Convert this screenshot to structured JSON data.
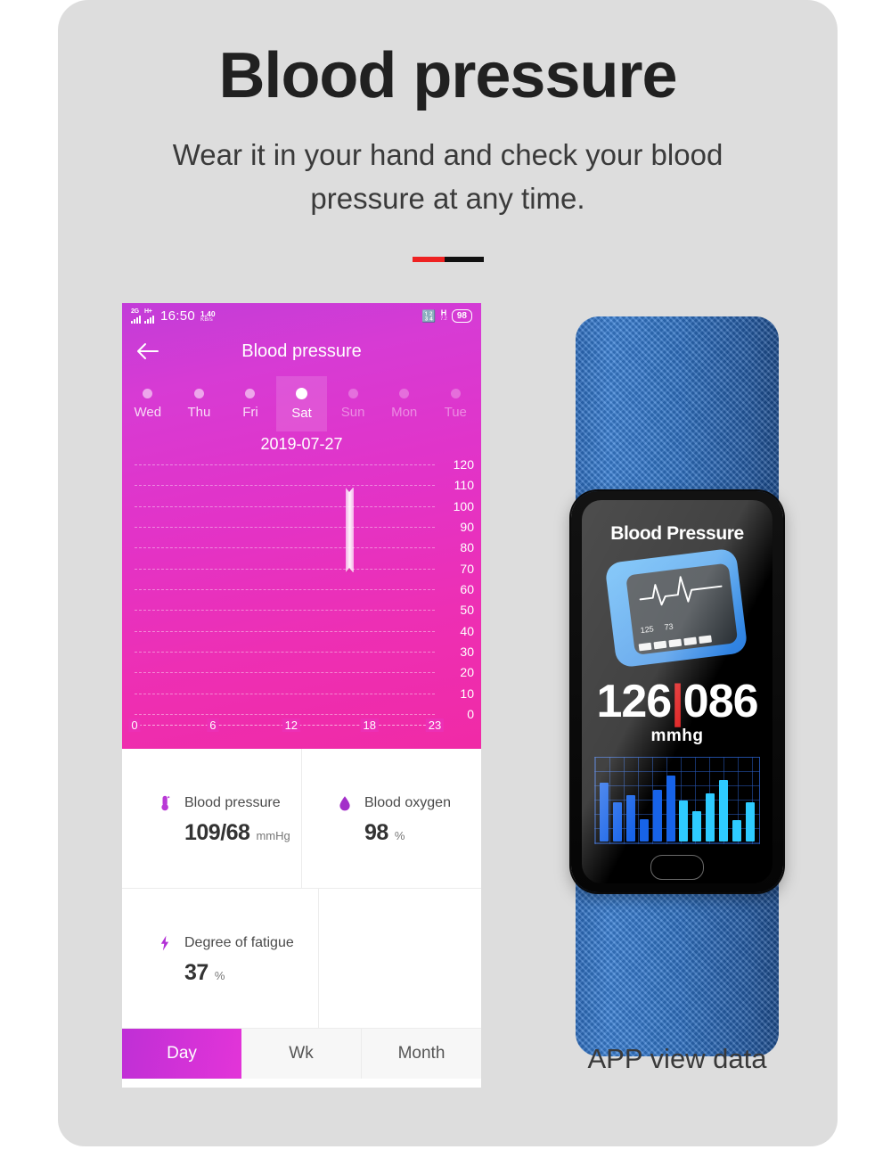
{
  "header": {
    "headline": "Blood pressure",
    "subline": "Wear it in your hand and check your blood pressure at any time.",
    "divider_red": "#ee2222",
    "divider_black": "#111111"
  },
  "phone": {
    "statusbar": {
      "net1": "2G",
      "net2": "H+",
      "time": "16:50",
      "speed_value": "1.40",
      "speed_unit": "KB/s",
      "bluetooth_icon": "bluetooth-icon",
      "hspa": "H",
      "hspa_sub": "7.2",
      "battery": "98"
    },
    "nav": {
      "back_icon": "back-arrow-icon",
      "title": "Blood pressure"
    },
    "days": [
      {
        "label": "Wed",
        "state": "normal"
      },
      {
        "label": "Thu",
        "state": "normal"
      },
      {
        "label": "Fri",
        "state": "normal"
      },
      {
        "label": "Sat",
        "state": "selected"
      },
      {
        "label": "Sun",
        "state": "dim"
      },
      {
        "label": "Mon",
        "state": "dim"
      },
      {
        "label": "Tue",
        "state": "dim"
      }
    ],
    "date": "2019-07-27",
    "cards": [
      {
        "icon": "thermometer-icon",
        "title": "Blood pressure",
        "value": "109/68",
        "unit": "mmHg"
      },
      {
        "icon": "blood-drop-icon",
        "title": "Blood oxygen",
        "value": "98",
        "unit": "%"
      },
      {
        "icon": "lightning-bolt-icon",
        "title": "Degree of fatigue",
        "value": "37",
        "unit": "%"
      }
    ],
    "tabs": [
      {
        "label": "Day",
        "active": true
      },
      {
        "label": "Wk",
        "active": false
      },
      {
        "label": "Month",
        "active": false
      }
    ]
  },
  "watch": {
    "title": "Blood Pressure",
    "icon": "blood-pressure-monitor-icon",
    "monitor_systolic": "125",
    "monitor_diastolic": "73",
    "systolic": "126",
    "separator": "|",
    "diastolic": "086",
    "unit": "mmhg",
    "button": "home-button",
    "band_color": "#2f73c6",
    "accent_color": "#2d7fe0"
  },
  "caption": "APP view data",
  "chart_data": [
    {
      "type": "bar",
      "title": "2019-07-27",
      "xlabel": "",
      "ylabel": "",
      "x": [
        16.5
      ],
      "categories": [
        "16:30"
      ],
      "series": [
        {
          "name": "Blood pressure range",
          "low": [
            68
          ],
          "high": [
            109
          ]
        }
      ],
      "values": [
        109
      ],
      "ylim": [
        0,
        120
      ],
      "yticks": [
        0,
        10,
        20,
        30,
        40,
        50,
        60,
        70,
        80,
        90,
        100,
        110,
        120
      ],
      "xlim": [
        0,
        23
      ],
      "xticks": [
        0,
        6,
        12,
        18,
        23
      ],
      "xticklabels": [
        "0",
        "6",
        "12",
        "18",
        "23"
      ],
      "grid": true,
      "legend": "none"
    },
    {
      "type": "bar",
      "title": "Watch heart-rate history",
      "categories": [
        "1",
        "2",
        "3",
        "4",
        "5",
        "6",
        "7",
        "8",
        "9",
        "10",
        "11",
        "12"
      ],
      "values": [
        78,
        52,
        62,
        30,
        68,
        88,
        54,
        40,
        64,
        82,
        28,
        52
      ],
      "colors": [
        "#1763e8",
        "#1763e8",
        "#1763e8",
        "#1763e8",
        "#1763e8",
        "#1763e8",
        "#2ecbff",
        "#2ecbff",
        "#2ecbff",
        "#2ecbff",
        "#2ecbff",
        "#2ecbff"
      ],
      "ylim": [
        0,
        100
      ],
      "grid": true,
      "legend": "none"
    }
  ]
}
